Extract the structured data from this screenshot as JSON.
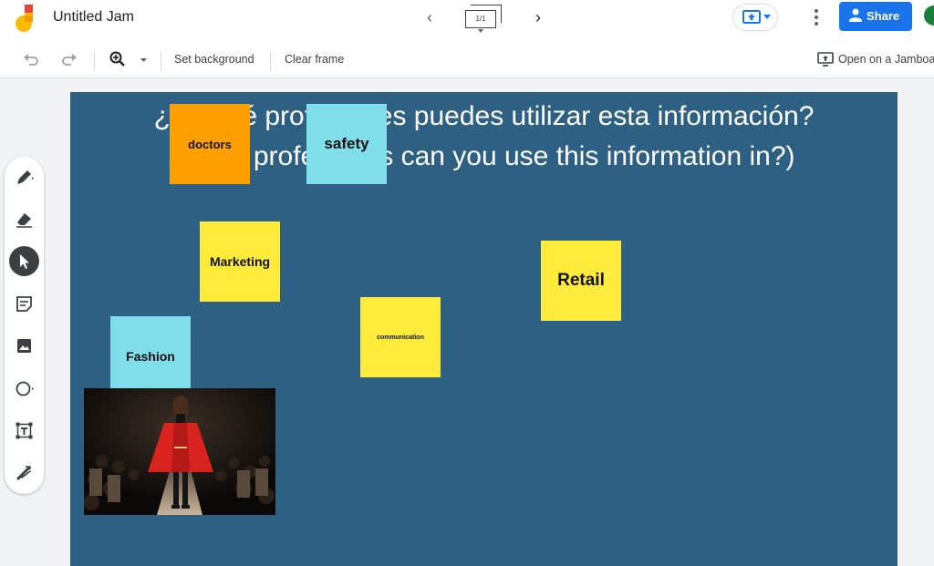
{
  "app": {
    "title": "Untitled Jam"
  },
  "frames": {
    "counter": "1/1"
  },
  "header": {
    "share_label": "Share"
  },
  "toolbar": {
    "set_background": "Set background",
    "clear_frame": "Clear frame",
    "open_on_jamboard": "Open on a Jamboa"
  },
  "canvas": {
    "heading_line1": "¿En qué profesiones puedes utilizar esta información?",
    "heading_line2": "(What professions can you use this information in?)",
    "background_color": "#2d6083",
    "notes": [
      {
        "text": "doctors",
        "color": "#ffa000"
      },
      {
        "text": "safety",
        "color": "#80deea"
      },
      {
        "text": "Marketing",
        "color": "#ffeb3b"
      },
      {
        "text": "Retail",
        "color": "#ffeb3b"
      },
      {
        "text": "communication",
        "color": "#ffeb3b"
      },
      {
        "text": "Fashion",
        "color": "#80deea"
      }
    ],
    "image": {
      "subject": "fashion-runway-model-red-coat"
    }
  },
  "sidebar": {
    "tools": [
      {
        "icon": "pen-icon"
      },
      {
        "icon": "eraser-icon"
      },
      {
        "icon": "select-icon",
        "active": true
      },
      {
        "icon": "sticky-note-icon"
      },
      {
        "icon": "image-icon"
      },
      {
        "icon": "circle-icon"
      },
      {
        "icon": "text-box-icon"
      },
      {
        "icon": "laser-icon"
      }
    ]
  },
  "colors": {
    "accent": "#1a73e8",
    "note_yellow": "#ffeb3b",
    "note_orange": "#ffa000",
    "note_cyan": "#80deea"
  }
}
